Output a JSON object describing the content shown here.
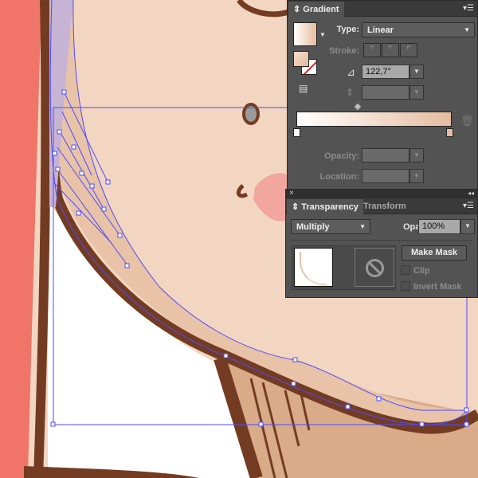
{
  "colors": {
    "skin": "#f3d6c1",
    "shade": "#e9c3a8",
    "outline": "#733c22",
    "hair": "#f07468",
    "lavender": "#c7b3d4",
    "shirt": "#d9ab88",
    "selection": "#4b4bff",
    "panel": "#535353"
  },
  "gradient_panel": {
    "tab": "Gradient",
    "type_label": "Type:",
    "type_value": "Linear",
    "stroke_label": "Stroke:",
    "angle_icon": "angle-icon",
    "angle_value": "122,7°",
    "aspect_icon": "aspect-ratio-icon",
    "aspect_value": "",
    "opacity_label": "Opacity:",
    "opacity_value": "",
    "location_label": "Location:",
    "location_value": "",
    "gradient_start": "#ffffff",
    "gradient_end": "#e6bca0"
  },
  "transparency_panel": {
    "tabs": [
      "Transparency",
      "Transform"
    ],
    "blend_mode": "Multiply",
    "opacity_label": "Opacity:",
    "opacity_value": "100%",
    "make_mask": "Make Mask",
    "clip": "Clip",
    "invert_mask": "Invert Mask"
  }
}
